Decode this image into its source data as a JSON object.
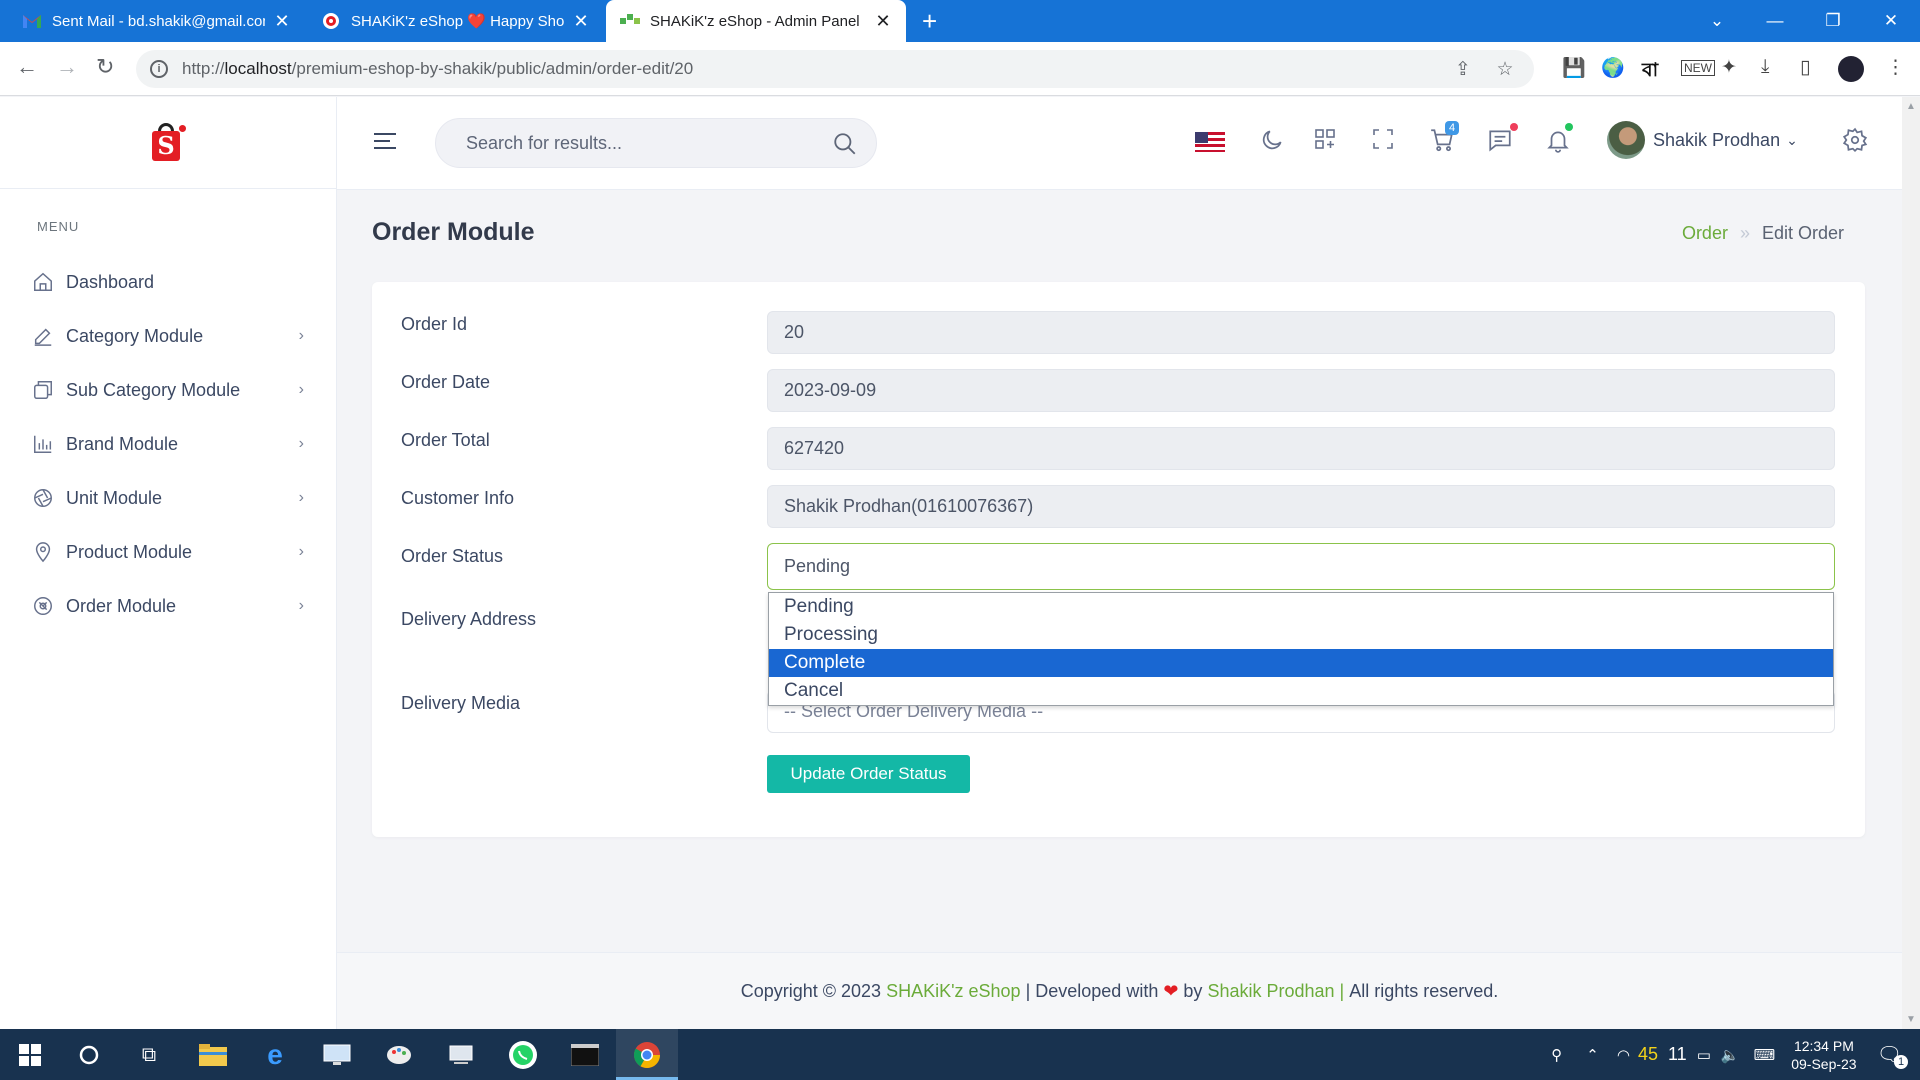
{
  "browser": {
    "tabs": [
      {
        "title": "Sent Mail - bd.shakik@gmail.com",
        "icon": "gmail-icon"
      },
      {
        "title": "SHAKiK'z eShop ❤️ Happy Shopping",
        "icon": "shop-icon"
      },
      {
        "title": "SHAKiK'z eShop - Admin Panel",
        "icon": "admin-icon"
      }
    ],
    "url_prefix": "http://",
    "url_host": "localhost",
    "url_path": "/premium-eshop-by-shakik/public/admin/order-edit/20"
  },
  "sidebar": {
    "menu_label": "MENU",
    "items": [
      {
        "label": "Dashboard",
        "icon": "home-icon",
        "has_children": false
      },
      {
        "label": "Category Module",
        "icon": "edit-icon",
        "has_children": true
      },
      {
        "label": "Sub Category Module",
        "icon": "layers-icon",
        "has_children": true
      },
      {
        "label": "Brand Module",
        "icon": "bar-chart-icon",
        "has_children": true
      },
      {
        "label": "Unit Module",
        "icon": "aperture-icon",
        "has_children": true
      },
      {
        "label": "Product Module",
        "icon": "map-pin-icon",
        "has_children": true
      },
      {
        "label": "Order Module",
        "icon": "order-icon",
        "has_children": true
      }
    ]
  },
  "header": {
    "search_placeholder": "Search for results...",
    "cart_count": "4",
    "user_name": "Shakik Prodhan"
  },
  "page": {
    "title": "Order Module",
    "breadcrumb": [
      "Order",
      "Edit Order"
    ]
  },
  "form": {
    "order_id": {
      "label": "Order Id",
      "value": "20"
    },
    "order_date": {
      "label": "Order Date",
      "value": "2023-09-09"
    },
    "order_total": {
      "label": "Order Total",
      "value": "627420"
    },
    "customer_info": {
      "label": "Customer Info",
      "value": "Shakik Prodhan(01610076367)"
    },
    "order_status": {
      "label": "Order Status",
      "value": "Pending",
      "options": [
        "Pending",
        "Processing",
        "Complete",
        "Cancel"
      ],
      "highlighted": "Complete"
    },
    "delivery_address": {
      "label": "Delivery Address"
    },
    "delivery_media": {
      "label": "Delivery Media",
      "placeholder": "-- Select Order Delivery Media --"
    },
    "submit_label": "Update Order Status"
  },
  "footer": {
    "copyright": "Copyright © 2023",
    "brand": "SHAKiK'z eShop",
    "developed": "| Developed with",
    "by": "by",
    "author": "Shakik Prodhan |",
    "rights": "All rights reserved."
  },
  "taskbar": {
    "temp_a": "45",
    "temp_b": "11",
    "time": "12:34 PM",
    "date": "09-Sep-23",
    "notif_count": "1"
  },
  "colors": {
    "accent_green": "#6bab3a",
    "button_teal": "#14b8a6",
    "select_highlight": "#1967d2",
    "chrome_blue": "#1673d6"
  }
}
